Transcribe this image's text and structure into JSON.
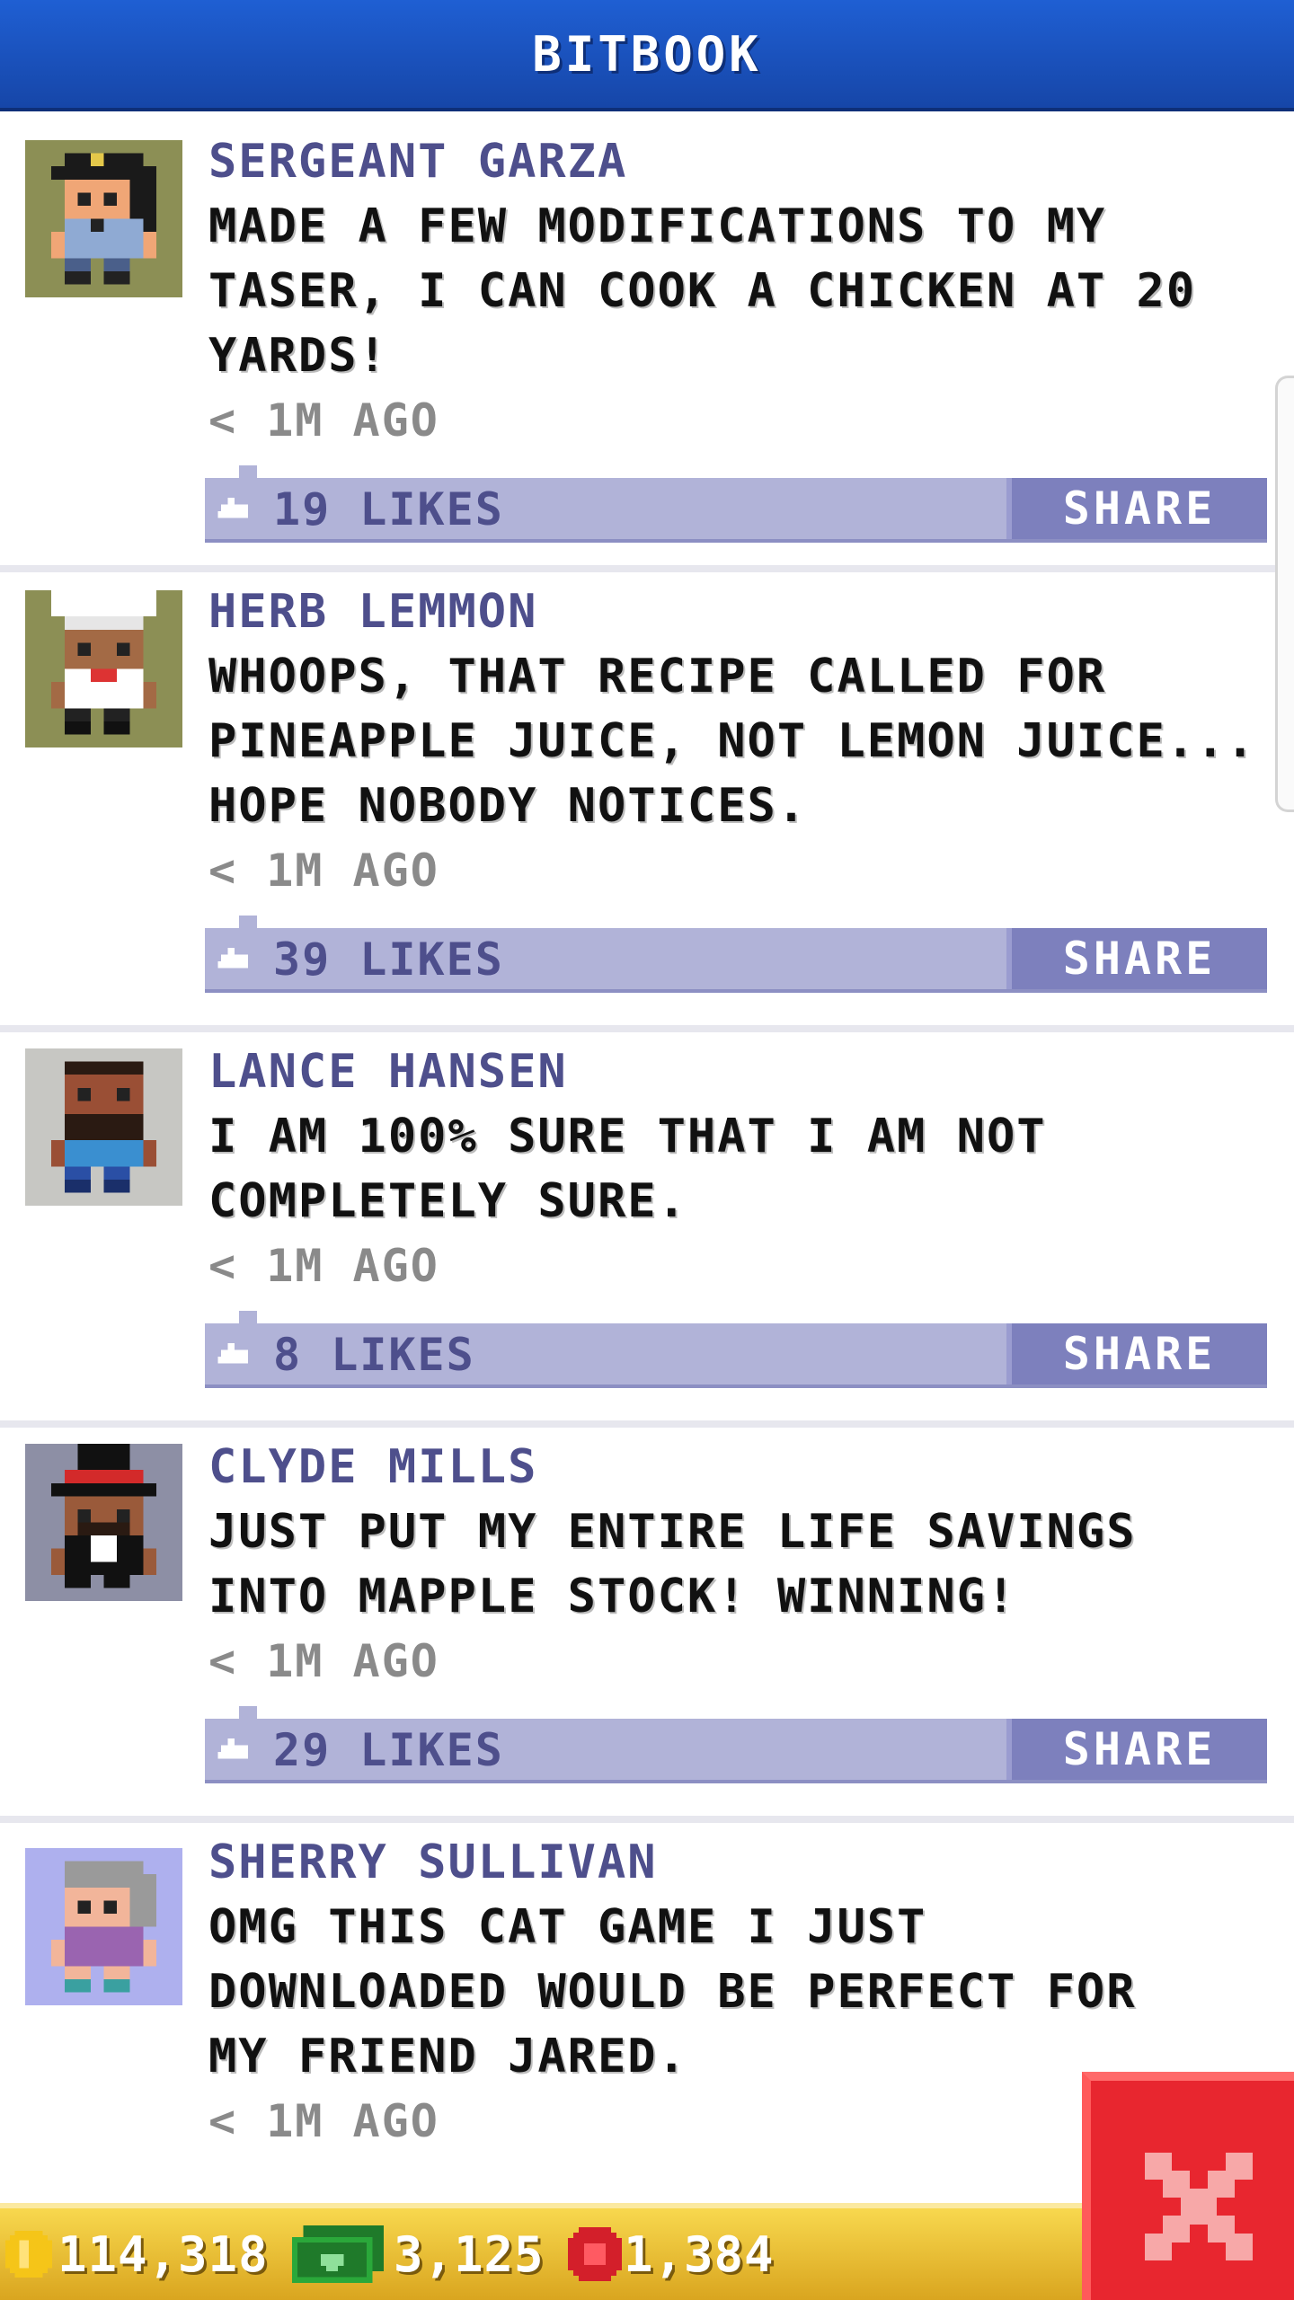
{
  "header": {
    "title": "BITBOOK"
  },
  "posts": [
    {
      "author": "SERGEANT GARZA",
      "lines": [
        "MADE A FEW MODIFICATIONS TO MY",
        "TASER, I CAN COOK A CHICKEN AT 20",
        "YARDS!"
      ],
      "time": "< 1M AGO",
      "likes": "19 LIKES",
      "share": "SHARE",
      "avatar_bg": "#8c8f55"
    },
    {
      "author": "HERB LEMMON",
      "lines": [
        "WHOOPS, THAT RECIPE CALLED FOR",
        "PINEAPPLE JUICE, NOT LEMON JUICE...",
        "HOPE NOBODY NOTICES."
      ],
      "time": "< 1M AGO",
      "likes": "39 LIKES",
      "share": "SHARE",
      "avatar_bg": "#8c8f55"
    },
    {
      "author": "LANCE HANSEN",
      "lines": [
        "I AM 100% SURE THAT I AM NOT",
        "COMPLETELY SURE."
      ],
      "time": "< 1M AGO",
      "likes": "8 LIKES",
      "share": "SHARE",
      "avatar_bg": "#c7c7c3"
    },
    {
      "author": "CLYDE MILLS",
      "lines": [
        "JUST PUT MY ENTIRE LIFE SAVINGS",
        "INTO MAPPLE STOCK! WINNING!"
      ],
      "time": "< 1M AGO",
      "likes": "29 LIKES",
      "share": "SHARE",
      "avatar_bg": "#8d8fa5"
    },
    {
      "author": "SHERRY SULLIVAN",
      "lines": [
        "OMG THIS CAT GAME I JUST",
        "DOWNLOADED WOULD BE PERFECT FOR",
        "MY FRIEND JARED."
      ],
      "time": "< 1M AGO",
      "avatar_bg": "#aeb0ee"
    }
  ],
  "bottom_bar": {
    "coins": "114,318",
    "bux": "3,125",
    "tickets": "1,384"
  },
  "colors": {
    "header": "#1f5fd3",
    "name": "#4e4f8c",
    "like_bar": "#b1b3d8",
    "share_button": "#7d80bd",
    "close_button": "#e8262f",
    "bottom_bar": "#f2c93a"
  }
}
